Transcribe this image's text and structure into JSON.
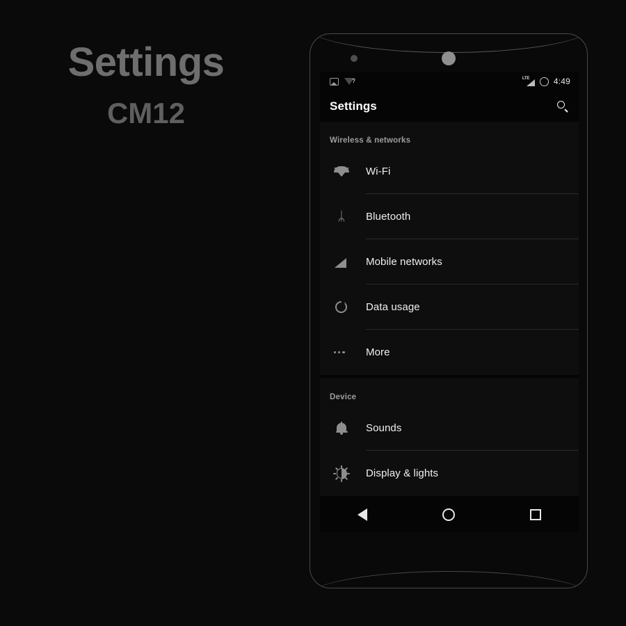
{
  "promo": {
    "title": "Settings",
    "subtitle": "CM12"
  },
  "colors": {
    "page_background": "#0a0a0a",
    "screen_background": "#050505",
    "card_background": "#0e0e0e",
    "primary_text": "#f0f0f0",
    "secondary_text": "#9d9d9d",
    "icon": "#8e8e8e",
    "divider": "#2a2a2a",
    "promo_text": "#6e6e6e"
  },
  "device": {
    "sensor_icon": "proximity-sensor-dot",
    "camera_icon": "front-camera-dot"
  },
  "statusbar": {
    "left_icons": [
      {
        "name": "screenshot-icon",
        "label": "screenshot"
      },
      {
        "name": "wifi-no-internet-icon",
        "label": "?"
      }
    ],
    "right_icons": [
      {
        "name": "lte-signal-icon",
        "label": "LTE"
      },
      {
        "name": "do-not-disturb-icon",
        "label": "dnd"
      }
    ],
    "time": "4:49"
  },
  "actionbar": {
    "title": "Settings",
    "search_icon": "search-icon"
  },
  "sections": [
    {
      "header": "Wireless & networks",
      "items": [
        {
          "label": "Wi-Fi",
          "icon": "wifi-icon"
        },
        {
          "label": "Bluetooth",
          "icon": "bluetooth-icon",
          "glyph": "ᛦ"
        },
        {
          "label": "Mobile networks",
          "icon": "signal-icon"
        },
        {
          "label": "Data usage",
          "icon": "data-usage-icon"
        },
        {
          "label": "More",
          "icon": "more-icon"
        }
      ]
    },
    {
      "header": "Device",
      "items": [
        {
          "label": "Sounds",
          "icon": "bell-icon"
        },
        {
          "label": "Display & lights",
          "icon": "brightness-icon"
        }
      ]
    }
  ],
  "navbar": {
    "back": "back-icon",
    "home": "home-icon",
    "recents": "recents-icon"
  }
}
